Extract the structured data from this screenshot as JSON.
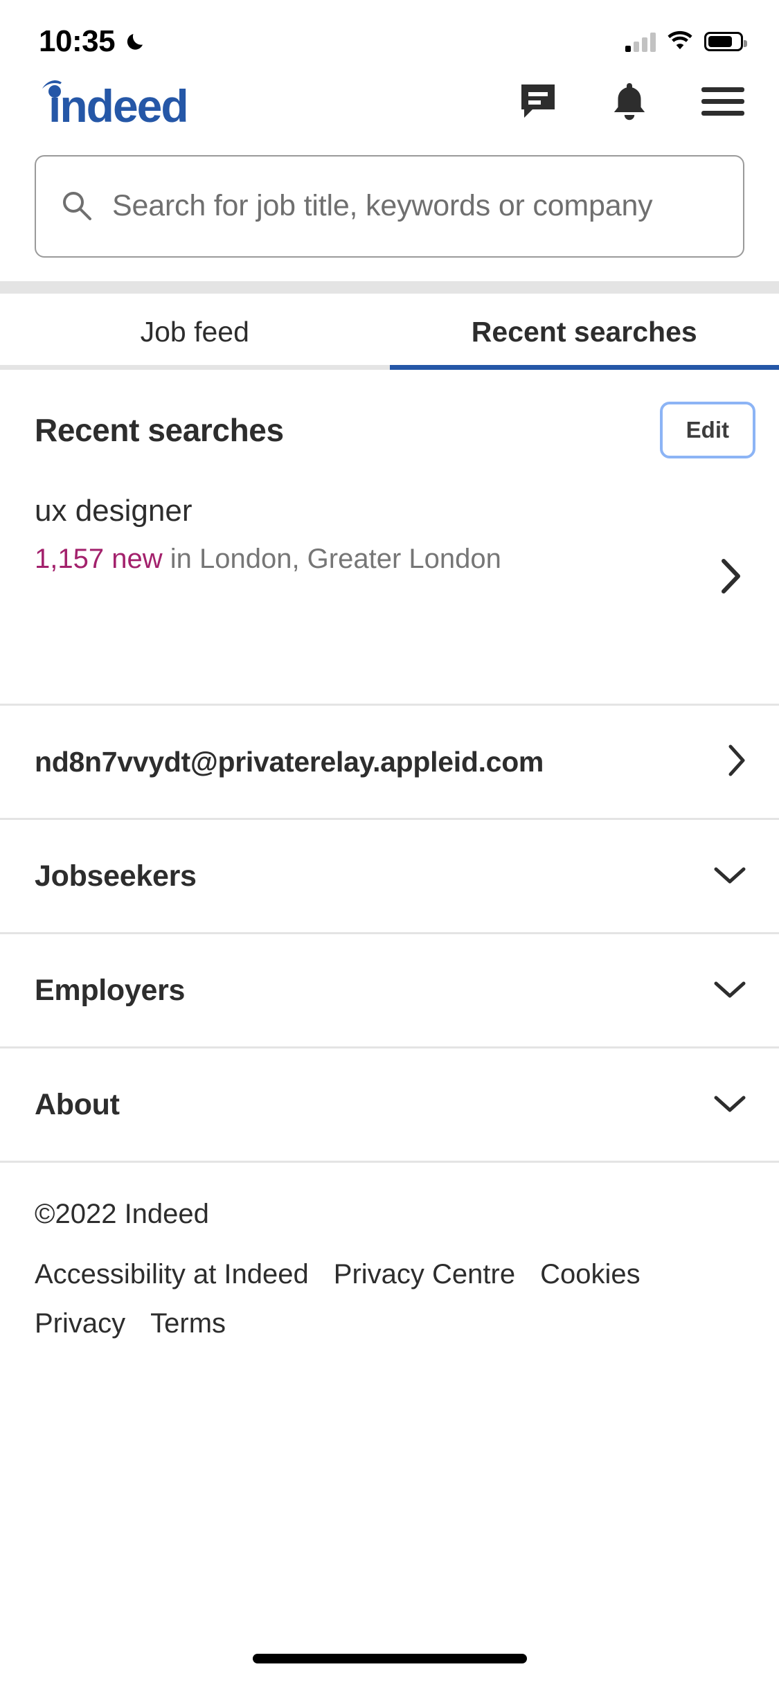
{
  "status_bar": {
    "time": "10:35",
    "dnd_icon": "crescent-moon-icon",
    "cellular_icon": "cellular-signal-icon",
    "wifi_icon": "wifi-icon",
    "battery_icon": "battery-icon"
  },
  "header": {
    "logo_text": "indeed",
    "logo_color": "#2557a7",
    "messages_icon": "message-icon",
    "notifications_icon": "bell-icon",
    "menu_icon": "hamburger-menu-icon"
  },
  "search": {
    "icon": "search-icon",
    "placeholder": "Search for job title, keywords or company",
    "value": ""
  },
  "tabs": [
    {
      "label": "Job feed",
      "active": false
    },
    {
      "label": "Recent searches",
      "active": true
    }
  ],
  "section": {
    "title": "Recent searches",
    "edit_label": "Edit"
  },
  "recent_searches": [
    {
      "query": "ux designer",
      "new_count": "1,157 new",
      "location": "in London, Greater London",
      "chevron_icon": "chevron-right-icon"
    }
  ],
  "account_row": {
    "email": "nd8n7vvydt@privaterelay.appleid.com",
    "chevron_icon": "chevron-right-icon"
  },
  "accordions": [
    {
      "label": "Jobseekers",
      "icon": "chevron-down-icon"
    },
    {
      "label": "Employers",
      "icon": "chevron-down-icon"
    },
    {
      "label": "About",
      "icon": "chevron-down-icon"
    }
  ],
  "footer": {
    "copyright": "©2022 Indeed",
    "links": [
      "Accessibility at Indeed",
      "Privacy Centre",
      "Cookies",
      "Privacy",
      "Terms"
    ]
  },
  "colors": {
    "brand_blue": "#2557a7",
    "accent_magenta": "#a3216c",
    "edit_border": "#8cb4f5",
    "divider": "#e4e4e4",
    "muted_text": "#767676"
  }
}
